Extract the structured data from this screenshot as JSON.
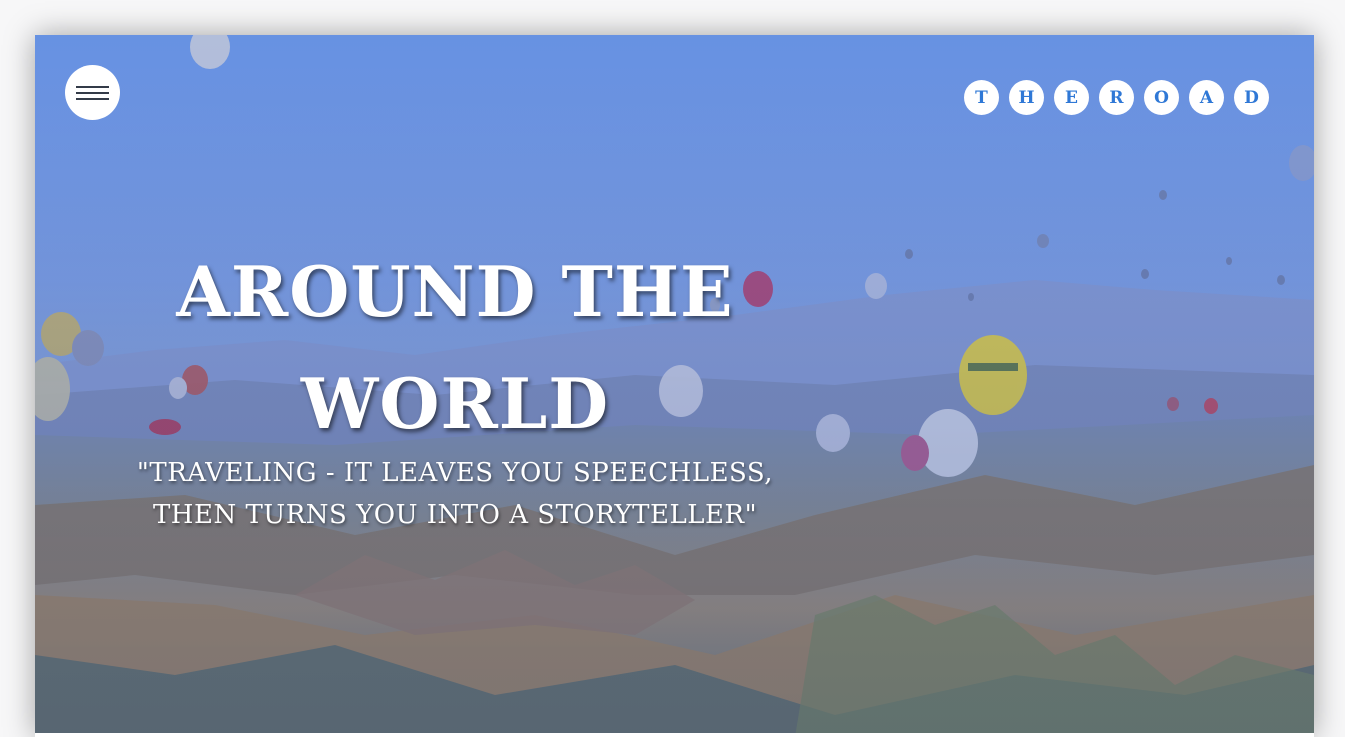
{
  "nav": {
    "menu_icon": "hamburger-icon",
    "brand_letters": [
      "T",
      "H",
      "E",
      "R",
      "O",
      "A",
      "D"
    ],
    "brand_color": "#2f78d6"
  },
  "hero": {
    "title_line1": "AROUND THE",
    "title_line2": "WORLD",
    "quote_line1": "\"TRAVELING - IT LEAVES YOU SPEECHLESS,",
    "quote_line2": "THEN TURNS YOU INTO A STORYTELLER\"",
    "overlay_color": "#4f73c9"
  }
}
